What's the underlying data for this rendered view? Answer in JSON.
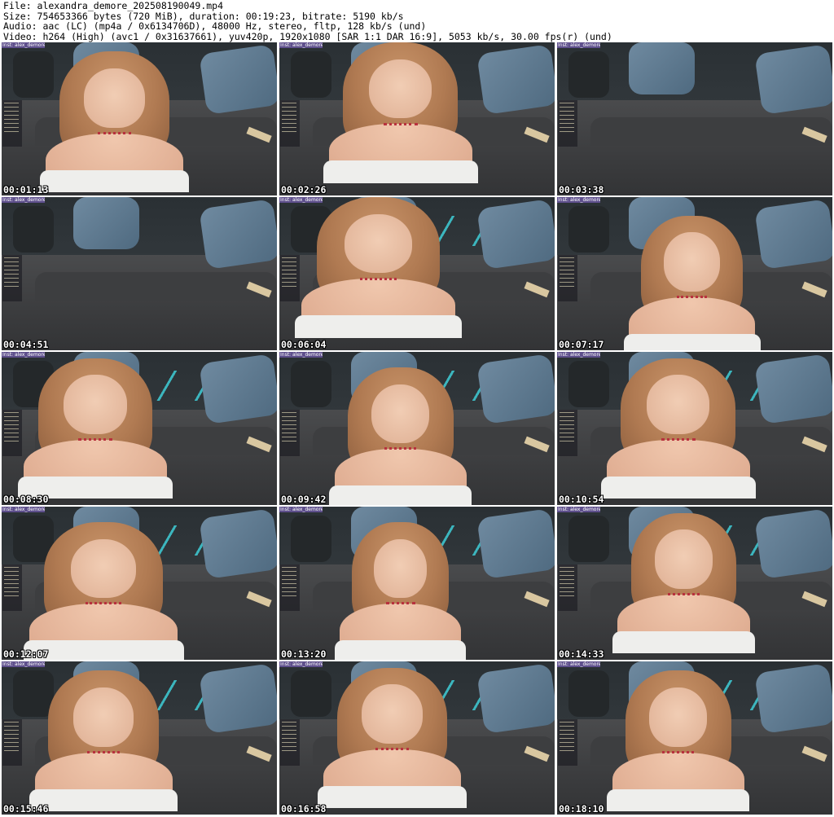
{
  "header": {
    "line1": "File: alexandra_demore_202508190049.mp4",
    "line2": "Size: 754653366 bytes (720 MiB), duration: 00:19:23, bitrate: 5190 kb/s",
    "line3": "Audio: aac (LC) (mp4a / 0x6134706D), 48000 Hz, stereo, fltp, 128 kb/s (und)",
    "line4": "Video: h264 (High) (avc1 / 0x31637661), yuv420p, 1920x1080 [SAR 1:1 DAR 16:9], 5053 kb/s, 30.00 fps(r) (und)"
  },
  "overlay_text": "Inst: alex_demore",
  "thumbnails": [
    {
      "timestamp": "00:01:13"
    },
    {
      "timestamp": "00:02:26"
    },
    {
      "timestamp": "00:03:38"
    },
    {
      "timestamp": "00:04:51"
    },
    {
      "timestamp": "00:06:04"
    },
    {
      "timestamp": "00:07:17"
    },
    {
      "timestamp": "00:08:30"
    },
    {
      "timestamp": "00:09:42"
    },
    {
      "timestamp": "00:10:54"
    },
    {
      "timestamp": "00:12:07"
    },
    {
      "timestamp": "00:13:20"
    },
    {
      "timestamp": "00:14:33"
    },
    {
      "timestamp": "00:15:46"
    },
    {
      "timestamp": "00:16:58"
    },
    {
      "timestamp": "00:18:10"
    }
  ],
  "colors": {
    "background": "#ffffff",
    "overlay_badge": "#5e4f8c",
    "timestamp_text": "#ffffff"
  }
}
